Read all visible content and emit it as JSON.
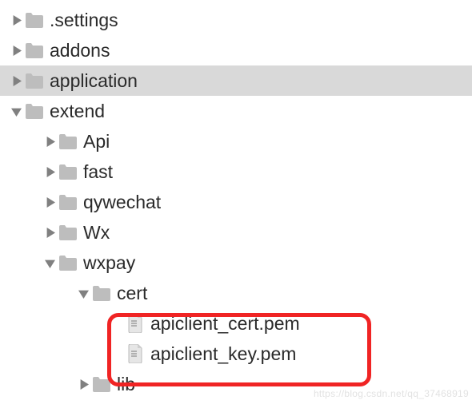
{
  "rows": [
    {
      "indent": 0,
      "expanded": false,
      "hasDisclosure": true,
      "kind": "folder",
      "label": ".settings",
      "selected": false
    },
    {
      "indent": 0,
      "expanded": false,
      "hasDisclosure": true,
      "kind": "folder",
      "label": "addons",
      "selected": false
    },
    {
      "indent": 0,
      "expanded": false,
      "hasDisclosure": true,
      "kind": "folder",
      "label": "application",
      "selected": true
    },
    {
      "indent": 0,
      "expanded": true,
      "hasDisclosure": true,
      "kind": "folder",
      "label": "extend",
      "selected": false
    },
    {
      "indent": 1,
      "expanded": false,
      "hasDisclosure": true,
      "kind": "folder",
      "label": "Api",
      "selected": false
    },
    {
      "indent": 1,
      "expanded": false,
      "hasDisclosure": true,
      "kind": "folder",
      "label": "fast",
      "selected": false
    },
    {
      "indent": 1,
      "expanded": false,
      "hasDisclosure": true,
      "kind": "folder",
      "label": "qywechat",
      "selected": false
    },
    {
      "indent": 1,
      "expanded": false,
      "hasDisclosure": true,
      "kind": "folder",
      "label": "Wx",
      "selected": false
    },
    {
      "indent": 1,
      "expanded": true,
      "hasDisclosure": true,
      "kind": "folder",
      "label": "wxpay",
      "selected": false
    },
    {
      "indent": 2,
      "expanded": true,
      "hasDisclosure": true,
      "kind": "folder",
      "label": "cert",
      "selected": false
    },
    {
      "indent": 3,
      "expanded": false,
      "hasDisclosure": false,
      "kind": "file",
      "label": "apiclient_cert.pem",
      "selected": false
    },
    {
      "indent": 3,
      "expanded": false,
      "hasDisclosure": false,
      "kind": "file",
      "label": "apiclient_key.pem",
      "selected": false
    },
    {
      "indent": 2,
      "expanded": false,
      "hasDisclosure": true,
      "kind": "folder",
      "label": "lib",
      "selected": false
    }
  ],
  "layout": {
    "indentUnit": 42,
    "calloutTop": 386,
    "calloutLeft": 134,
    "calloutWidth": 330,
    "calloutHeight": 92
  },
  "watermark": "https://blog.csdn.net/qq_37468919"
}
